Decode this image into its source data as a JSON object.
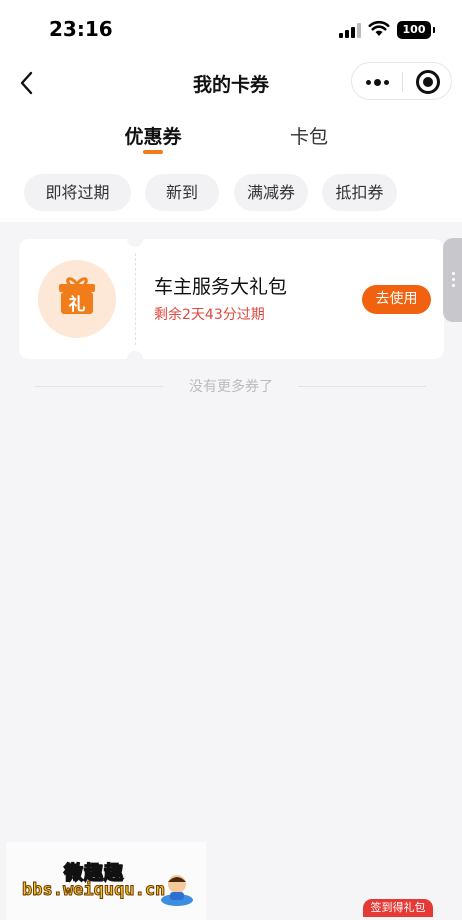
{
  "status_bar": {
    "time": "23:16",
    "battery": "100"
  },
  "nav": {
    "title": "我的卡券"
  },
  "tabs": [
    {
      "label": "优惠券",
      "active": true
    },
    {
      "label": "卡包",
      "active": false
    }
  ],
  "filters": [
    "即将过期",
    "新到",
    "满减券",
    "抵扣券"
  ],
  "coupon": {
    "icon_text": "礼",
    "title": "车主服务大礼包",
    "expire": "剩余2天43分过期",
    "button": "去使用"
  },
  "no_more_text": "没有更多券了",
  "watermark": {
    "cn": "微趣趣",
    "url": "bbs.weiququ.cn"
  },
  "signin_badge": "签到得礼包",
  "colors": {
    "accent": "#f07d1a",
    "button": "#f0620f",
    "expire_text": "#e0473d",
    "gift_bg": "#fde7d6"
  }
}
